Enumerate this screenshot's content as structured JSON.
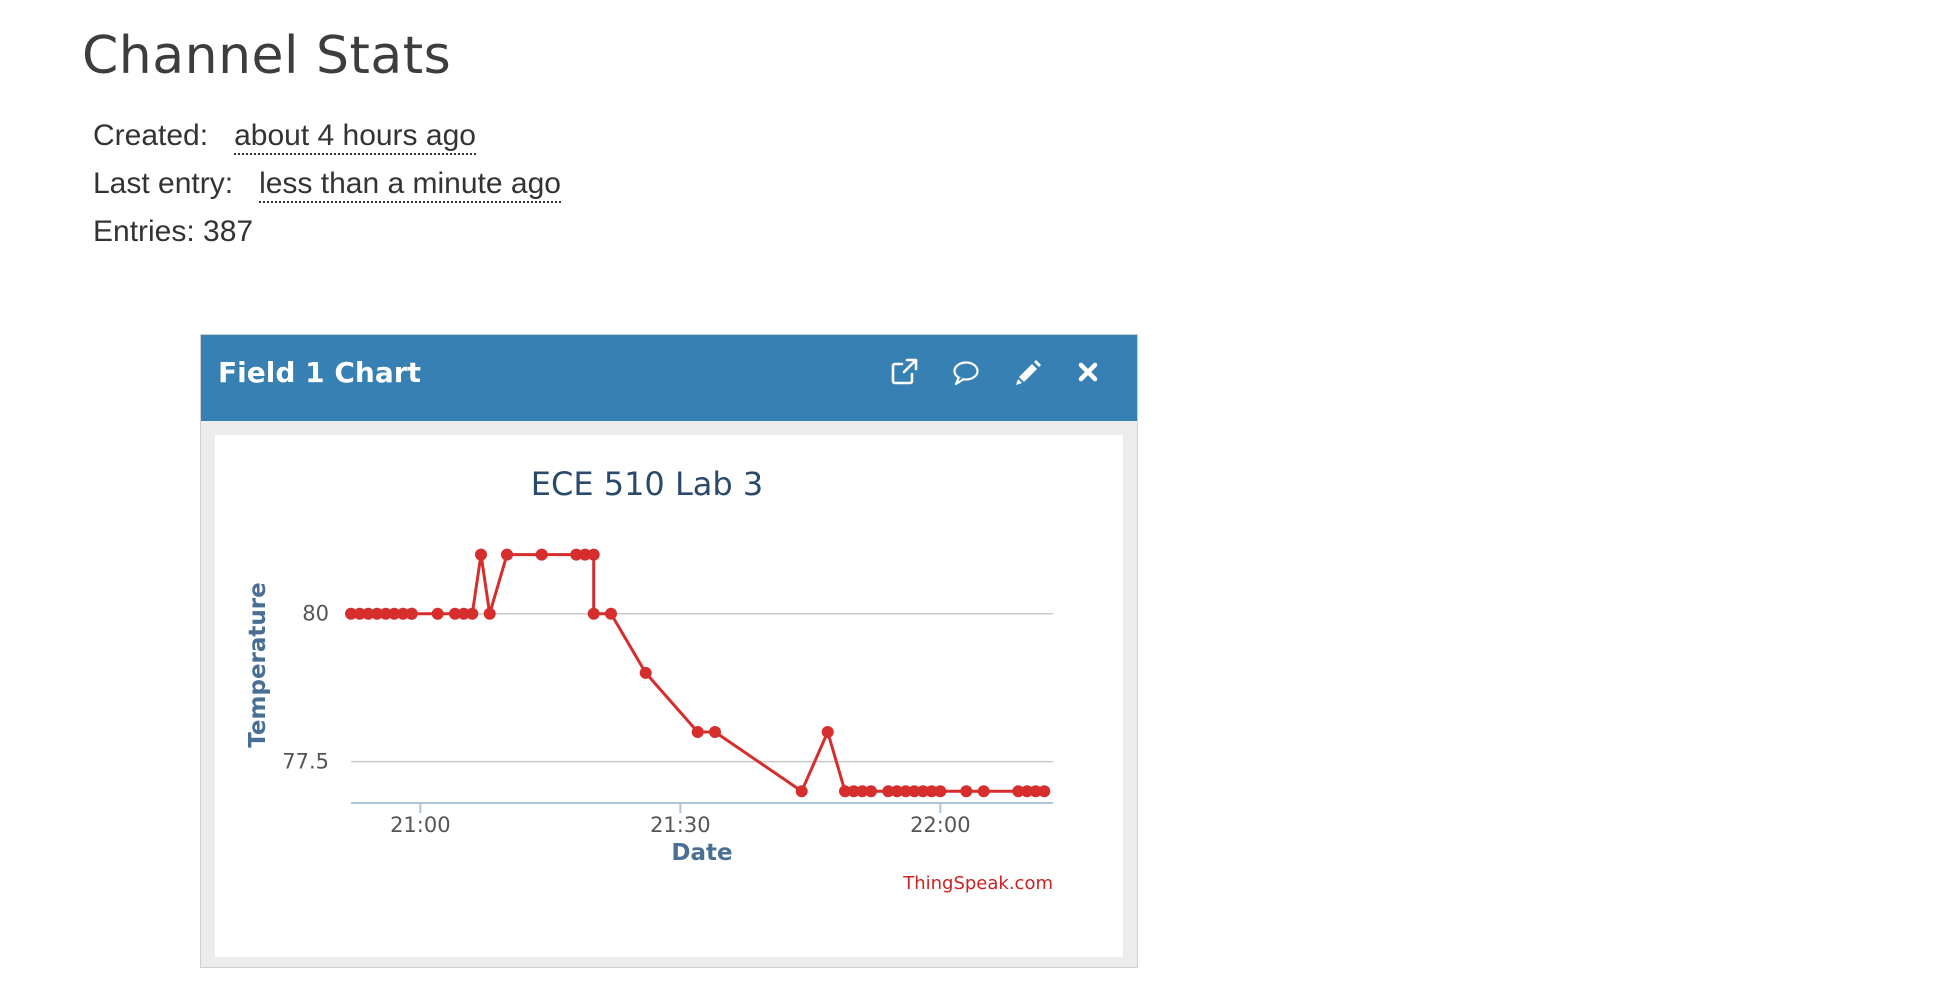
{
  "page": {
    "title": "Channel Stats"
  },
  "stats": {
    "created_label": "Created:",
    "created_value": "about 4 hours ago",
    "last_entry_label": "Last entry:",
    "last_entry_value": "less than a minute ago",
    "entries_label": "Entries: 387"
  },
  "panel": {
    "title": "Field 1 Chart",
    "icons": [
      "external-link-icon",
      "comment-icon",
      "pencil-icon",
      "close-icon"
    ],
    "header_color": "#3780b4"
  },
  "chart_data": {
    "type": "line",
    "title": "ECE 510 Lab 3",
    "xlabel": "Date",
    "ylabel": "Temperature",
    "credit": "ThingSpeak.com",
    "color": "#d62d2d",
    "xlim": [
      "20:52",
      "22:13"
    ],
    "ylim": [
      76.8,
      81.5
    ],
    "xticks": [
      "21:00",
      "21:30",
      "22:00"
    ],
    "yticks": [
      "77.5",
      "80"
    ],
    "grid": true,
    "series": [
      {
        "x": [
          "20:52",
          "20:53",
          "20:54",
          "20:55",
          "20:56",
          "20:57",
          "20:58",
          "20:59",
          "20:59",
          "21:02",
          "21:04",
          "21:05",
          "21:06",
          "21:07",
          "21:08",
          "21:10",
          "21:14",
          "21:18",
          "21:19",
          "21:20",
          "21:20",
          "21:22",
          "21:26",
          "21:32",
          "21:34",
          "21:44",
          "21:47",
          "21:49",
          "21:50",
          "21:51",
          "21:52",
          "21:54",
          "21:55",
          "21:56",
          "21:57",
          "21:58",
          "21:59",
          "22:00",
          "22:03",
          "22:05",
          "22:09",
          "22:10",
          "22:11",
          "22:12"
        ],
        "y": [
          80,
          80,
          80,
          80,
          80,
          80,
          80,
          80,
          80,
          80,
          80,
          80,
          80,
          81,
          80,
          81,
          81,
          81,
          81,
          81,
          80,
          80,
          79,
          78,
          78,
          77,
          78,
          77,
          77,
          77,
          77,
          77,
          77,
          77,
          77,
          77,
          77,
          77,
          77,
          77,
          77,
          77,
          77,
          77
        ]
      }
    ]
  }
}
